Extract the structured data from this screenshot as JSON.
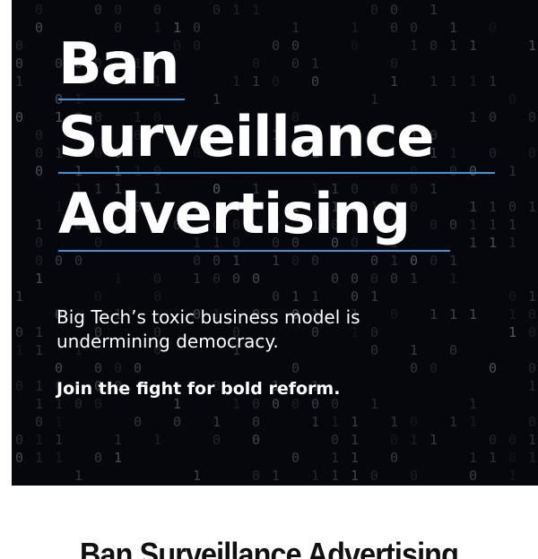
{
  "hero": {
    "heading_line1": "Ban",
    "heading_line2": "Surveillance",
    "heading_line3": "Advertising",
    "tagline": "Big Tech’s toxic business model is undermining democracy.",
    "cta": "Join the fight for bold reform.",
    "background_color": "#05070c",
    "accent_color": "#3f93dc"
  },
  "article": {
    "title": "Ban Surveillance Advertising"
  }
}
